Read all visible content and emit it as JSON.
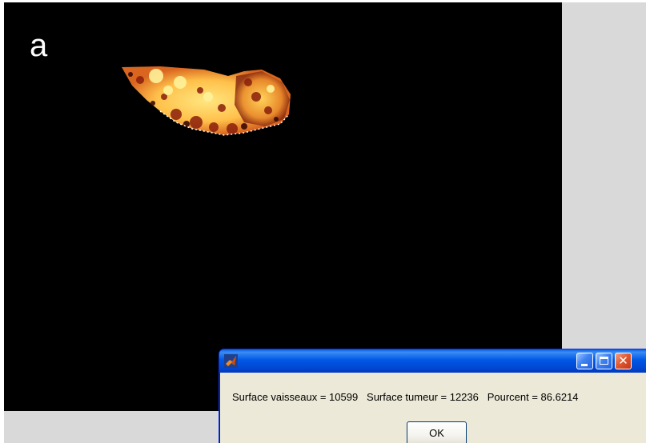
{
  "figure": {
    "panel_label": "a",
    "background_color": "#d9d9d9",
    "image_background": "#000000",
    "colormap": "hot"
  },
  "dialog": {
    "app_icon": "matlab-icon",
    "title": "",
    "message": "Surface vaisseaux = 10599   Surface tumeur = 12236   Pourcent = 86.6214",
    "ok_label": "OK",
    "window_buttons": [
      "minimize-icon",
      "maximize-icon",
      "close-icon"
    ],
    "close_glyph": "✕",
    "titlebar_color": "#0058e6"
  }
}
